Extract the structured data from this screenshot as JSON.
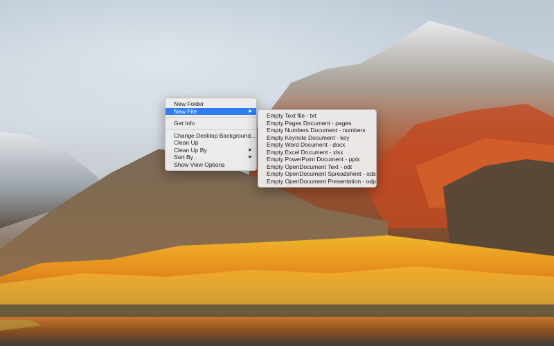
{
  "context_menu": {
    "items": [
      {
        "label": "New Folder",
        "has_submenu": false
      },
      {
        "label": "New File",
        "has_submenu": true,
        "highlighted": true
      },
      {
        "label": "Get Info",
        "has_submenu": false
      },
      {
        "label": "Change Desktop Background...",
        "has_submenu": false
      },
      {
        "label": "Clean Up",
        "has_submenu": false
      },
      {
        "label": "Clean Up By",
        "has_submenu": true
      },
      {
        "label": "Sort By",
        "has_submenu": true
      },
      {
        "label": "Show View Options",
        "has_submenu": false
      }
    ],
    "submenu_arrow": "▶"
  },
  "new_file_submenu": {
    "items": [
      "Empty Text file - txt",
      "Empty Pages Document - pages",
      "Empty Numbers Document - numbers",
      "Empty Keynote Document - key",
      "Empty Word Document - docx",
      "Empty Excel Document - xlsx",
      "Empty PowerPoint Document - pptx",
      "Empty OpenDocument Text - odt",
      "Empty OpenDocument Spreadsheet - ods",
      "Empty OpenDocument Presentation - odp"
    ]
  },
  "colors": {
    "highlight": "#2f7ef6",
    "menu_bg": "#ececec"
  }
}
